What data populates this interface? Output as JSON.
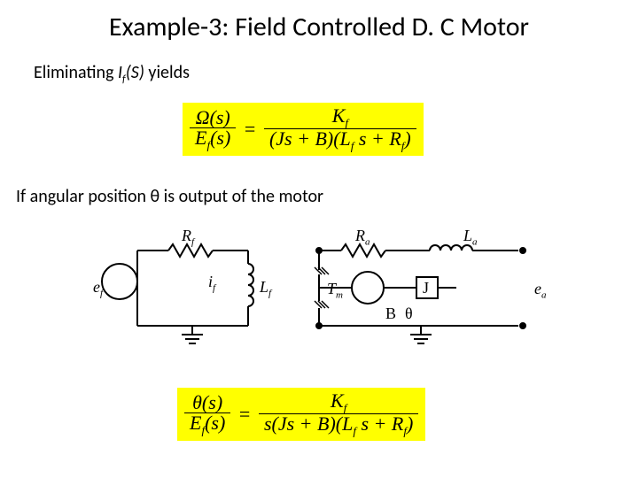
{
  "title": "Example-3: Field Controlled D. C Motor",
  "line1": {
    "pre": "Eliminating ",
    "var": "I",
    "var_sub": "f",
    "arg": "(S)",
    "post": " yields"
  },
  "formula1": {
    "num_left": "Ω(s)",
    "den_left_pre": "E",
    "den_left_sub": "f",
    "den_left_post": "(s)",
    "eq": "=",
    "rhs_num_pre": "K",
    "rhs_num_sub": "f",
    "rhs_den_pre": "(Js + B)(L",
    "rhs_den_mid_sub": "f",
    "rhs_den_mid": " s + R",
    "rhs_den_sub2": "f",
    "rhs_den_post": ")"
  },
  "line2": "If angular position θ is output of the motor",
  "circuit": {
    "ef": "e",
    "ef_sub": "f",
    "Rf": "R",
    "Rf_sub": "f",
    "if": "i",
    "if_sub": "f",
    "Lf": "L",
    "Lf_sub": "f",
    "Ra": "R",
    "Ra_sub": "a",
    "La": "L",
    "La_sub": "a",
    "Tm": "T",
    "Tm_sub": "m",
    "J": "J",
    "B": "B",
    "theta": "θ",
    "ea": "e",
    "ea_sub": "a"
  },
  "formula2": {
    "num_left": "θ(s)",
    "den_left_pre": "E",
    "den_left_sub": "f",
    "den_left_post": "(s)",
    "eq": "=",
    "rhs_num_pre": "K",
    "rhs_num_sub": "f",
    "rhs_den_pre": "s(Js + B)(L",
    "rhs_den_mid_sub": "f",
    "rhs_den_mid": " s + R",
    "rhs_den_sub2": "f",
    "rhs_den_post": ")"
  }
}
